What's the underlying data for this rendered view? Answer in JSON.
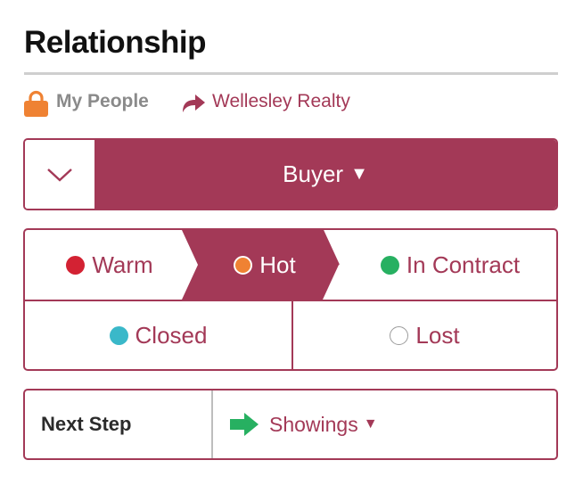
{
  "title": "Relationship",
  "meta": {
    "scope_label": "My People",
    "brokerage": "Wellesley Realty",
    "icons": [
      "lock-icon",
      "share-arrow-icon"
    ]
  },
  "type_selector": {
    "value": "Buyer",
    "caret": "▼",
    "toggle_icon": "chevron-down-icon"
  },
  "stages": {
    "selected": "Hot",
    "options": [
      {
        "label": "Warm",
        "color": "#d32233"
      },
      {
        "label": "Hot",
        "color": "#ef8233"
      },
      {
        "label": "In Contract",
        "color": "#27b061"
      },
      {
        "label": "Closed",
        "color": "#3ab8c9"
      },
      {
        "label": "Lost",
        "color": "#ffffff"
      }
    ]
  },
  "next_step": {
    "label": "Next Step",
    "value": "Showings",
    "caret": "▼",
    "icon": "green-arrow-icon"
  },
  "colors": {
    "accent": "#a33957",
    "lock": "#ef8233"
  }
}
